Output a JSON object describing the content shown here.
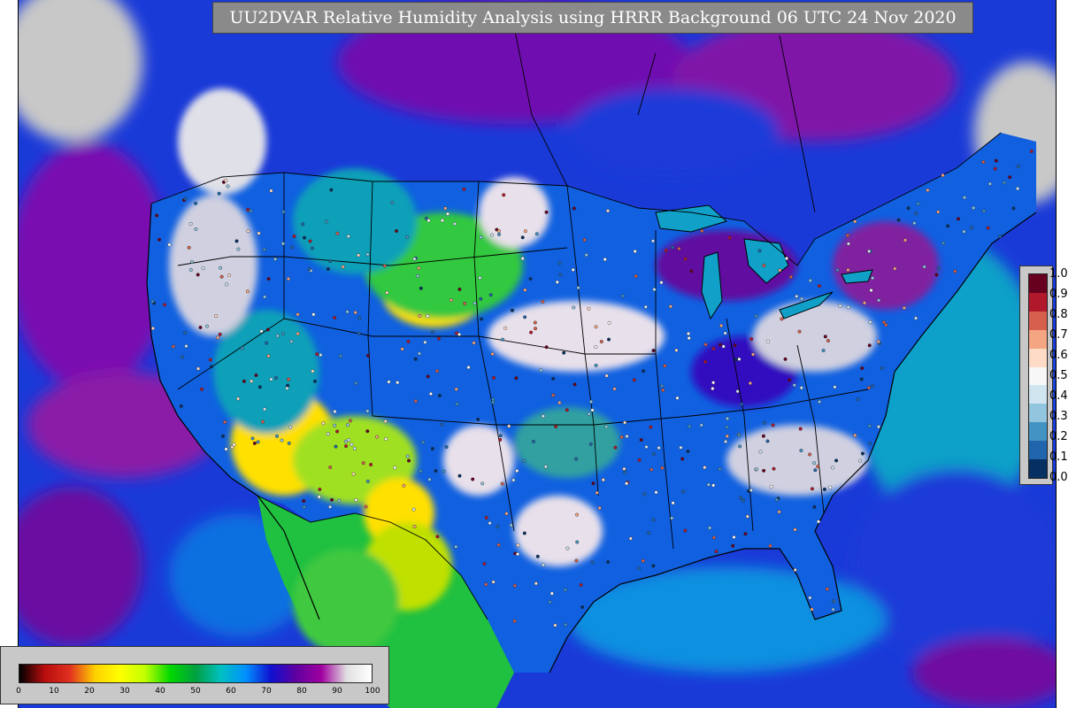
{
  "title": "UU2DVAR Relative Humidity Analysis using HRRR Background 06 UTC 24 Nov 2020",
  "obs_legend": {
    "labels": [
      "1.0",
      "0.9",
      "0.8",
      "0.7",
      "0.6",
      "0.5",
      "0.4",
      "0.3",
      "0.2",
      "0.1",
      "0.0"
    ],
    "colors": [
      "#67001f",
      "#b2182b",
      "#d6604d",
      "#f4a582",
      "#fddbc7",
      "#f7f7f7",
      "#d1e5f0",
      "#92c5de",
      "#4393c3",
      "#2166ac",
      "#053061"
    ]
  },
  "field_legend": {
    "labels": [
      "0",
      "10",
      "20",
      "30",
      "40",
      "50",
      "60",
      "70",
      "80",
      "90",
      "100"
    ],
    "colors": [
      "#000000",
      "#b80d0d",
      "#e03020",
      "#ffd000",
      "#ffff00",
      "#c0ff00",
      "#00d800",
      "#00a040",
      "#00c0c0",
      "#0090ff",
      "#1010d0",
      "#6000a0",
      "#a000a0",
      "#e0e0e0",
      "#ffffff"
    ]
  },
  "map_colors": {
    "ocean_moist": "#1a3ad8",
    "ocean_humid": "#6a0fa0",
    "ocean_mid": "#1090e0",
    "land_dry": "#ffe000",
    "land_semi": "#20c040",
    "land_moist": "#1060e0",
    "saturated": "#e8e0ea",
    "no_data": "#c8c8c8"
  }
}
